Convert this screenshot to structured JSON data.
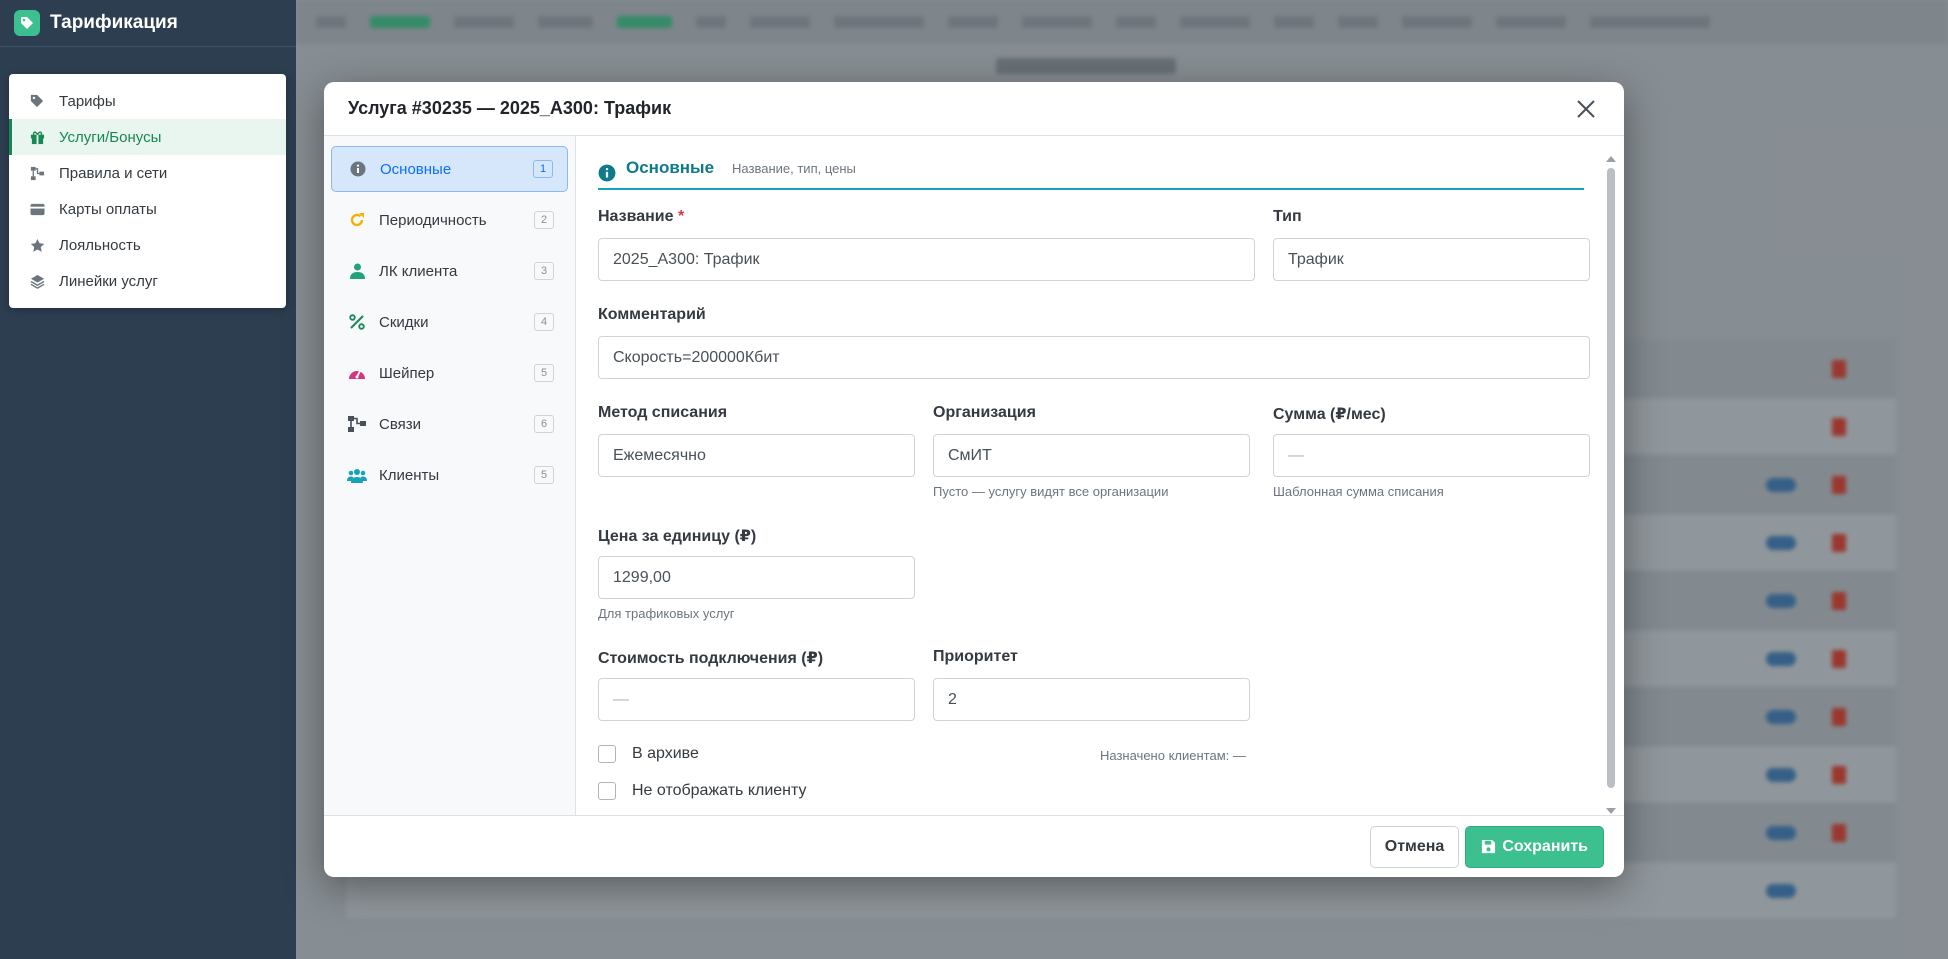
{
  "app": {
    "title": "Тарификация",
    "accent_color": "#3cc08f"
  },
  "sidebar": {
    "items": [
      {
        "label": "Тарифы",
        "icon": "tag-icon"
      },
      {
        "label": "Услуги/Бонусы",
        "icon": "gift-icon",
        "active": true
      },
      {
        "label": "Правила и сети",
        "icon": "network-icon"
      },
      {
        "label": "Карты оплаты",
        "icon": "credit-card-icon"
      },
      {
        "label": "Лояльность",
        "icon": "star-icon"
      },
      {
        "label": "Линейки услуг",
        "icon": "layers-icon"
      }
    ]
  },
  "modal": {
    "title": "Услуга #30235 — 2025_A300: Трафик",
    "tabs": [
      {
        "label": "Основные",
        "count": "1",
        "icon": "info-icon",
        "active": true
      },
      {
        "label": "Периодичность",
        "count": "2",
        "icon": "redo-icon"
      },
      {
        "label": "ЛК клиента",
        "count": "3",
        "icon": "user-icon"
      },
      {
        "label": "Скидки",
        "count": "4",
        "icon": "percent-icon"
      },
      {
        "label": "Шейпер",
        "count": "5",
        "icon": "speedometer-icon"
      },
      {
        "label": "Связи",
        "count": "6",
        "icon": "diagram-icon"
      },
      {
        "label": "Клиенты",
        "count": "5",
        "icon": "users-icon"
      }
    ],
    "section": {
      "title": "Основные",
      "subtitle": "Название, тип, цены"
    },
    "fields": {
      "name": {
        "label": "Название",
        "required_mark": "*",
        "value": "2025_A300: Трафик"
      },
      "type": {
        "label": "Тип",
        "value": "Трафик"
      },
      "comment": {
        "label": "Комментарий",
        "value": "Скорость=200000Кбит"
      },
      "method": {
        "label": "Метод списания",
        "value": "Ежемесячно"
      },
      "org": {
        "label": "Организация",
        "value": "СмИТ",
        "help": "Пусто — услугу видят все организации"
      },
      "sum": {
        "label": "Сумма (₽/мес)",
        "placeholder": "—",
        "help": "Шаблонная сумма списания"
      },
      "unit_price": {
        "label": "Цена за единицу (₽)",
        "value": "1299,00",
        "help": "Для трафиковых услуг"
      },
      "connect_cost": {
        "label": "Стоимость подключения (₽)",
        "placeholder": "—"
      },
      "priority": {
        "label": "Приоритет",
        "value": "2"
      }
    },
    "checks": {
      "archive": "В архиве",
      "hide_client": "Не отображать клиенту"
    },
    "assigned": "Назначено клиентам: —",
    "buttons": {
      "cancel": "Отмена",
      "save": "Сохранить"
    }
  }
}
